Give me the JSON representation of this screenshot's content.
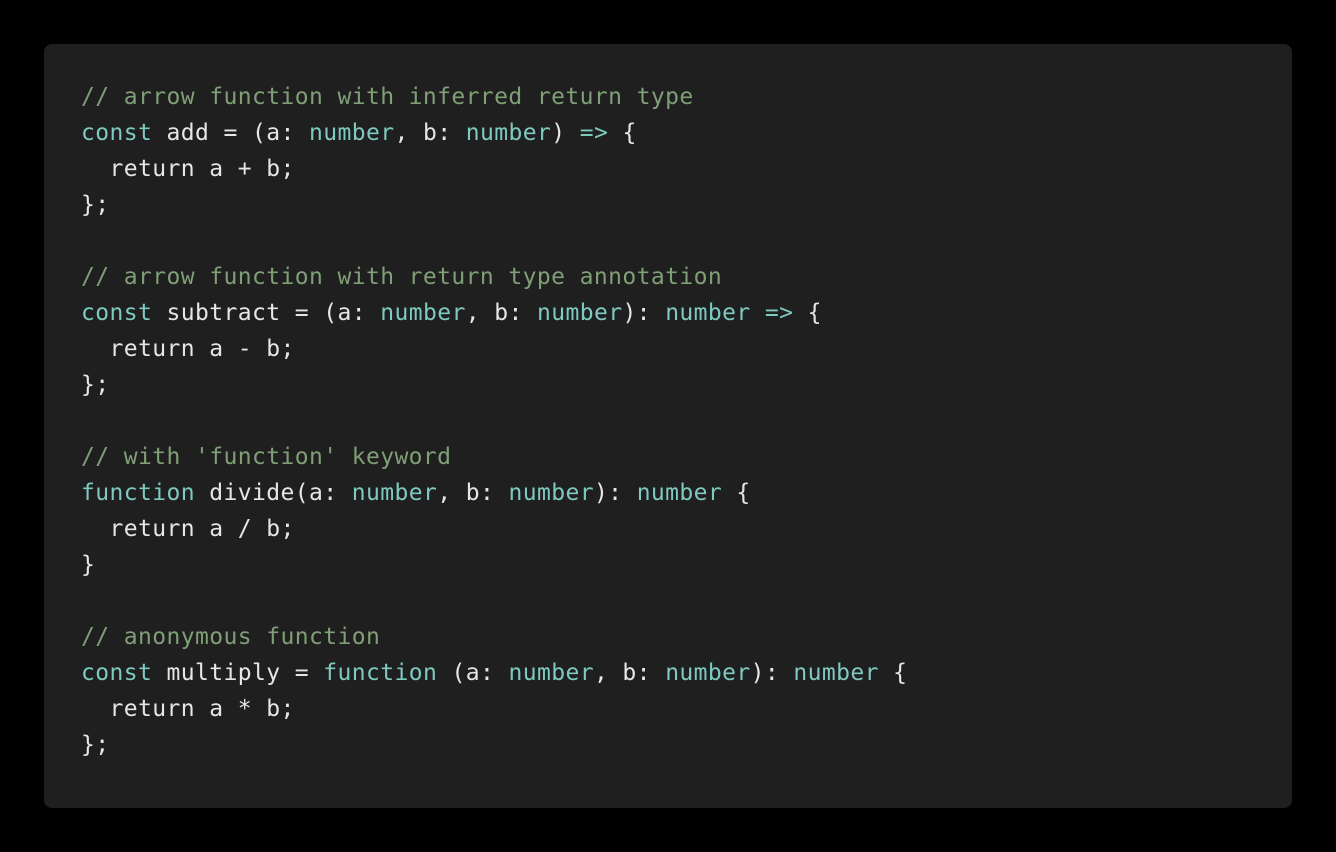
{
  "colors": {
    "background": "#000000",
    "card": "#1f1f1f",
    "text": "#e6e6e6",
    "comment": "#7f9f77",
    "keyword": "#7ec9c0"
  },
  "code": {
    "lines": [
      [
        {
          "cls": "c",
          "text": "// arrow function with inferred return type"
        }
      ],
      [
        {
          "cls": "k",
          "text": "const"
        },
        {
          "cls": "p",
          "text": " add = (a: "
        },
        {
          "cls": "t",
          "text": "number"
        },
        {
          "cls": "p",
          "text": ", b: "
        },
        {
          "cls": "t",
          "text": "number"
        },
        {
          "cls": "p",
          "text": ") "
        },
        {
          "cls": "k",
          "text": "=>"
        },
        {
          "cls": "p",
          "text": " {"
        }
      ],
      [
        {
          "cls": "p",
          "text": "  return a + b;"
        }
      ],
      [
        {
          "cls": "p",
          "text": "};"
        }
      ],
      [],
      [
        {
          "cls": "c",
          "text": "// arrow function with return type annotation"
        }
      ],
      [
        {
          "cls": "k",
          "text": "const"
        },
        {
          "cls": "p",
          "text": " subtract = (a: "
        },
        {
          "cls": "t",
          "text": "number"
        },
        {
          "cls": "p",
          "text": ", b: "
        },
        {
          "cls": "t",
          "text": "number"
        },
        {
          "cls": "p",
          "text": "): "
        },
        {
          "cls": "t",
          "text": "number"
        },
        {
          "cls": "p",
          "text": " "
        },
        {
          "cls": "k",
          "text": "=>"
        },
        {
          "cls": "p",
          "text": " {"
        }
      ],
      [
        {
          "cls": "p",
          "text": "  return a - b;"
        }
      ],
      [
        {
          "cls": "p",
          "text": "};"
        }
      ],
      [],
      [
        {
          "cls": "c",
          "text": "// with 'function' keyword"
        }
      ],
      [
        {
          "cls": "k",
          "text": "function"
        },
        {
          "cls": "p",
          "text": " divide(a: "
        },
        {
          "cls": "t",
          "text": "number"
        },
        {
          "cls": "p",
          "text": ", b: "
        },
        {
          "cls": "t",
          "text": "number"
        },
        {
          "cls": "p",
          "text": "): "
        },
        {
          "cls": "t",
          "text": "number"
        },
        {
          "cls": "p",
          "text": " {"
        }
      ],
      [
        {
          "cls": "p",
          "text": "  return a / b;"
        }
      ],
      [
        {
          "cls": "p",
          "text": "}"
        }
      ],
      [],
      [
        {
          "cls": "c",
          "text": "// anonymous function"
        }
      ],
      [
        {
          "cls": "k",
          "text": "const"
        },
        {
          "cls": "p",
          "text": " multiply = "
        },
        {
          "cls": "k",
          "text": "function"
        },
        {
          "cls": "p",
          "text": " (a: "
        },
        {
          "cls": "t",
          "text": "number"
        },
        {
          "cls": "p",
          "text": ", b: "
        },
        {
          "cls": "t",
          "text": "number"
        },
        {
          "cls": "p",
          "text": "): "
        },
        {
          "cls": "t",
          "text": "number"
        },
        {
          "cls": "p",
          "text": " {"
        }
      ],
      [
        {
          "cls": "p",
          "text": "  return a * b;"
        }
      ],
      [
        {
          "cls": "p",
          "text": "};"
        }
      ]
    ]
  }
}
